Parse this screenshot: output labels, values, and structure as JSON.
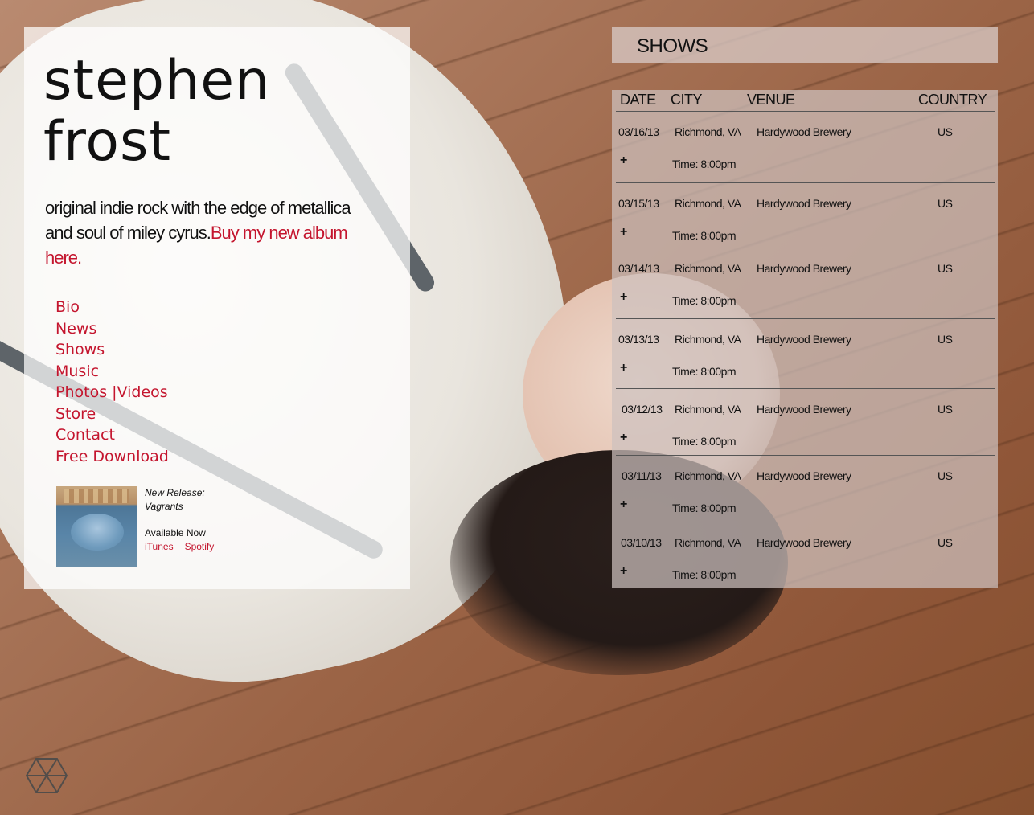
{
  "site": {
    "title_line1": "stephen",
    "title_line2": "frost",
    "tagline": "original indie rock with the edge of metallica and soul of miley cyrus.",
    "buy_link": "Buy my new album here."
  },
  "nav": [
    {
      "label": "Bio"
    },
    {
      "label": "News"
    },
    {
      "label": "Shows"
    },
    {
      "label": "Music"
    },
    {
      "label": "Photos |Videos"
    },
    {
      "label": "Store"
    },
    {
      "label": "Contact"
    },
    {
      "label": "Free Download"
    }
  ],
  "release": {
    "label": "New Release:",
    "title": "Vagrants",
    "available": "Available Now",
    "itunes": "iTunes",
    "spotify": "Spotify"
  },
  "shows": {
    "header": "SHOWS",
    "columns": {
      "date": "DATE",
      "city": "CITY",
      "venue": "VENUE",
      "country": "COUNTRY"
    },
    "rows": [
      {
        "date": "03/16/13",
        "city": "Richmond, VA",
        "venue": "Hardywood Brewery",
        "country": "US",
        "plus": "+",
        "time": "Time: 8:00pm"
      },
      {
        "date": "03/15/13",
        "city": "Richmond, VA",
        "venue": "Hardywood Brewery",
        "country": "US",
        "plus": "+",
        "time": "Time: 8:00pm"
      },
      {
        "date": "03/14/13",
        "city": "Richmond, VA",
        "venue": "Hardywood Brewery",
        "country": "US",
        "plus": "+",
        "time": "Time: 8:00pm"
      },
      {
        "date": "03/13/13",
        "city": "Richmond, VA",
        "venue": "Hardywood Brewery",
        "country": "US",
        "plus": "+",
        "time": "Time: 8:00pm"
      },
      {
        "date": "03/12/13",
        "city": "Richmond, VA",
        "venue": "Hardywood Brewery",
        "country": "US",
        "plus": "+",
        "time": "Time: 8:00pm"
      },
      {
        "date": "03/11/13",
        "city": "Richmond, VA",
        "venue": "Hardywood Brewery",
        "country": "US",
        "plus": "+",
        "time": "Time: 8:00pm"
      },
      {
        "date": "03/10/13",
        "city": "Richmond, VA",
        "venue": "Hardywood Brewery",
        "country": "US",
        "plus": "+",
        "time": "Time: 8:00pm"
      }
    ]
  },
  "colors": {
    "accent": "#c4152e",
    "text": "#111111"
  },
  "icons": {
    "logo": "hexagon-logo-icon",
    "expand": "plus-icon"
  }
}
